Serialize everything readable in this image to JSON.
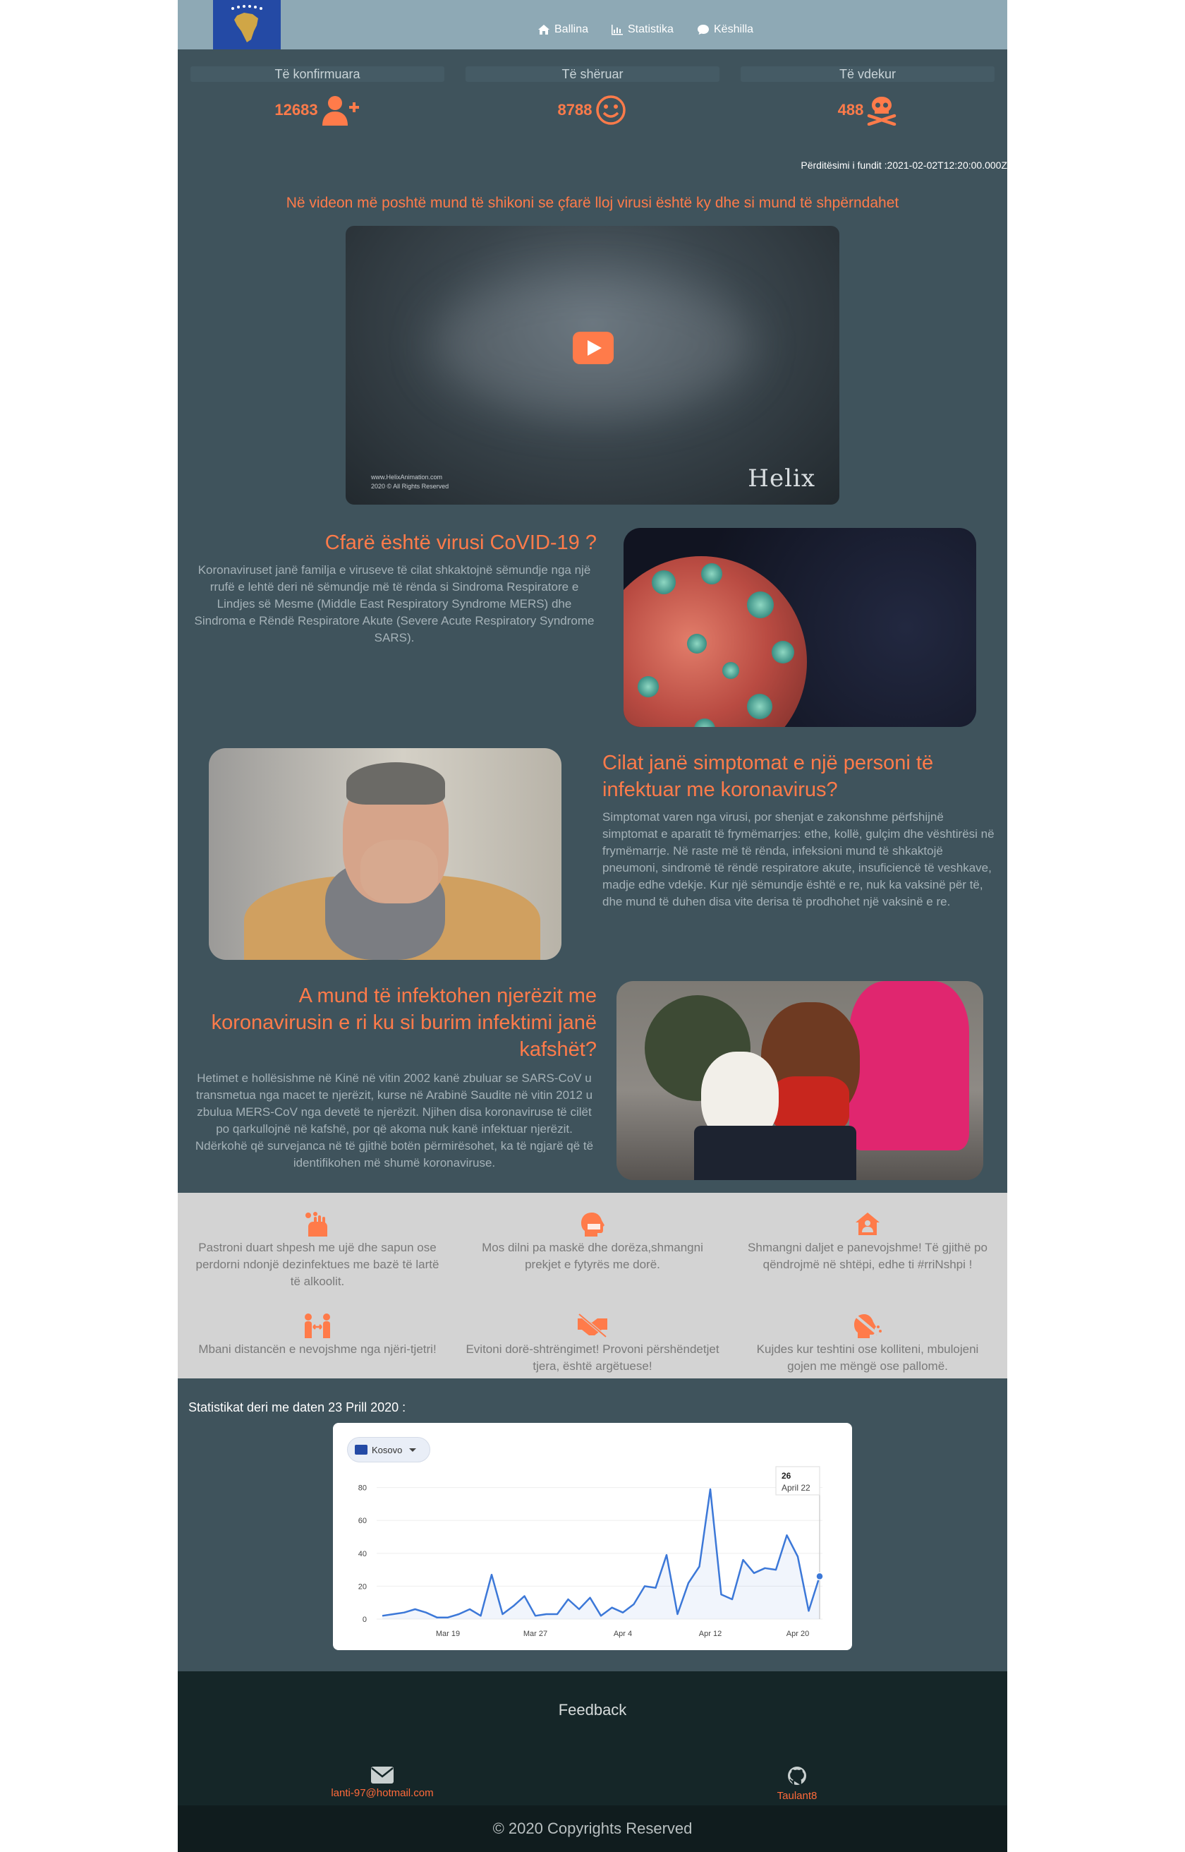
{
  "nav": {
    "links": [
      {
        "label": "Ballina",
        "icon": "home-icon"
      },
      {
        "label": "Statistika",
        "icon": "bar-chart-icon"
      },
      {
        "label": "Këshilla",
        "icon": "chat-icon"
      }
    ]
  },
  "stats": [
    {
      "label": "Të konfirmuara",
      "value": "12683",
      "icon": "user-plus-icon"
    },
    {
      "label": "Të shëruar",
      "value": "8788",
      "icon": "smile-icon"
    },
    {
      "label": "Të vdekur",
      "value": "488",
      "icon": "skull-crossbones-icon"
    }
  ],
  "updated": "Përditësimi i fundit :2021-02-02T12:20:00.000Z",
  "video": {
    "heading": "Në videon më poshtë mund të shikoni se çfarë lloj virusi është ky dhe si mund të shpërndahet",
    "credit_line1": "www.HelixAnimation.com",
    "credit_line2": "2020 © All Rights Reserved",
    "logo": "Helix"
  },
  "sections": [
    {
      "title": "Cfarë është virusi CoVID-19 ?",
      "text": "Koronaviruset janë familja e viruseve të cilat shkaktojnë sëmundje nga një rrufë e lehtë deri në sëmundje më të rënda si Sindroma Respiratore e Lindjes së Mesme (Middle East Respiratory Syndrome MERS) dhe Sindroma e Rëndë Respiratore Akute (Severe Acute Respiratory Syndrome SARS)."
    },
    {
      "title": "Cilat janë simptomat e një personi të infektuar me koronavirus?",
      "text": "Simptomat varen nga virusi, por shenjat e zakonshme përfshijnë simptomat e aparatit të frymëmarrjes: ethe, kollë, gulçim dhe vështirësi në frymëmarrje. Në raste më të rënda, infeksioni mund të shkaktojë pneumoni, sindromë të rëndë respiratore akute, insuficiencë të veshkave, madje edhe vdekje. Kur një sëmundje është e re, nuk ka vaksinë për të, dhe mund të duhen disa vite derisa të prodhohet një vaksinë e re."
    },
    {
      "title": "A mund të infektohen njerëzit me koronavirusin e ri ku si burim infektimi janë kafshët?",
      "text": "Hetimet e hollësishme në Kinë në vitin 2002 kanë zbuluar se SARS-CoV u transmetua nga macet te njerëzit, kurse në Arabinë Saudite në vitin 2012 u zbulua MERS-CoV nga devetë te njerëzit. Njihen disa koronaviruse të cilët po qarkullojnë në kafshë, por që akoma nuk kanë infektuar njerëzit. Ndërkohë që survejanca në të gjithë botën përmirësohet, ka të ngjarë që të identifikohen më shumë koronaviruse."
    }
  ],
  "tips": [
    {
      "text": "Pastroni duart shpesh me ujë dhe sapun ose perdorni ndonjë dezinfektues me bazë të lartë të alkoolit.",
      "icon": "hands-wash-icon"
    },
    {
      "text": "Mos dilni pa maskë dhe dorëza,shmangni prekjet e fytyrës me dorë.",
      "icon": "head-mask-icon"
    },
    {
      "text": "Shmangni daljet e panevojshme! Të gjithë po qëndrojmë në shtëpi, edhe ti #rriNshpi !",
      "icon": "house-user-icon"
    },
    {
      "text": "Mbani distancën e nevojshme nga njëri-tjetri!",
      "icon": "people-arrows-icon"
    },
    {
      "text": "Evitoni dorë-shtrëngimet! Provoni përshëndetjet tjera, është argëtuese!",
      "icon": "handshake-slash-icon"
    },
    {
      "text": "Kujdes kur teshtini ose kolliteni, mbulojeni gojen me mëngë ose pallomë.",
      "icon": "head-cough-icon"
    }
  ],
  "chart": {
    "heading": "Statistikat deri me daten 23 Prill 2020 :",
    "region": "Kosovo",
    "accent": "#3c78d8"
  },
  "chart_data": {
    "type": "line",
    "x": [
      "Mar 13",
      "Mar 14",
      "Mar 15",
      "Mar 16",
      "Mar 17",
      "Mar 18",
      "Mar 19",
      "Mar 20",
      "Mar 21",
      "Mar 22",
      "Mar 23",
      "Mar 24",
      "Mar 25",
      "Mar 26",
      "Mar 27",
      "Mar 28",
      "Mar 29",
      "Mar 30",
      "Mar 31",
      "Apr 1",
      "Apr 2",
      "Apr 3",
      "Apr 4",
      "Apr 5",
      "Apr 6",
      "Apr 7",
      "Apr 8",
      "Apr 9",
      "Apr 10",
      "Apr 11",
      "Apr 12",
      "Apr 13",
      "Apr 14",
      "Apr 15",
      "Apr 16",
      "Apr 17",
      "Apr 18",
      "Apr 19",
      "Apr 20",
      "Apr 21",
      "Apr 22"
    ],
    "series": [
      {
        "values": [
          2,
          3,
          4,
          6,
          4,
          1,
          1,
          3,
          6,
          2,
          27,
          3,
          8,
          14,
          2,
          3,
          3,
          12,
          6,
          13,
          2,
          7,
          4,
          9,
          20,
          19,
          39,
          3,
          22,
          32,
          79,
          15,
          12,
          36,
          28,
          31,
          30,
          51,
          38,
          5,
          26
        ]
      }
    ],
    "xticks": [
      "Mar 19",
      "Mar 27",
      "Apr 4",
      "Apr 12",
      "Apr 20"
    ],
    "yticks": [
      0,
      20,
      40,
      60,
      80
    ],
    "ylim": [
      0,
      85
    ],
    "tooltip": {
      "value": "26",
      "date": "April 22"
    }
  },
  "feedback": {
    "title": "Feedback",
    "email": "lanti-97@hotmail.com",
    "github": "Taulant8"
  },
  "footer": {
    "copyright": "© 2020 Copyrights Reserved"
  }
}
